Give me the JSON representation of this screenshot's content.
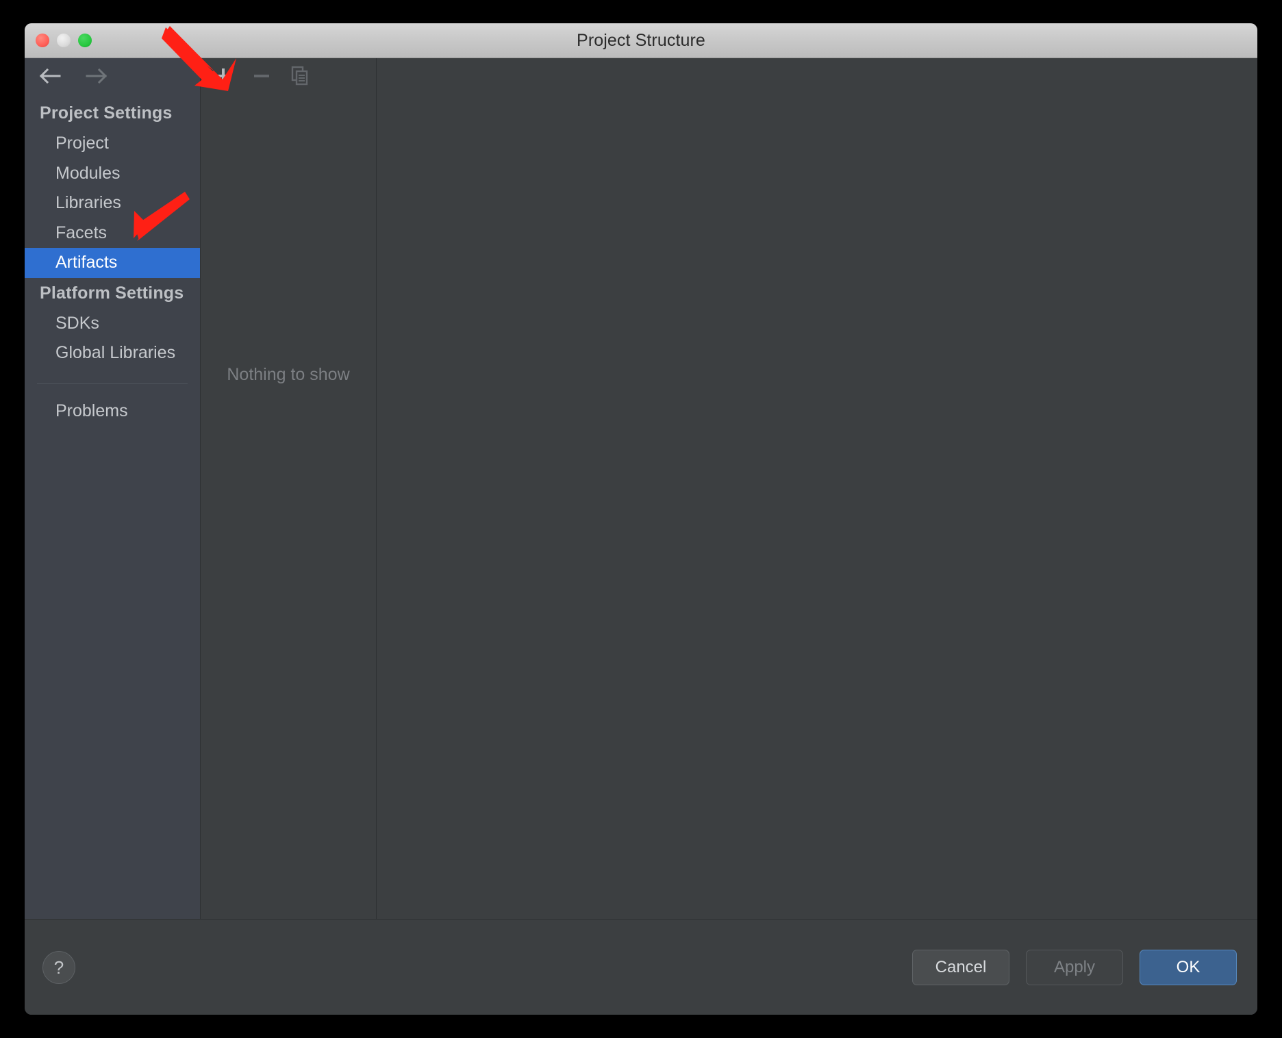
{
  "window": {
    "title": "Project Structure",
    "traffic_lights": [
      "close-red",
      "minimize-yellow",
      "maximize-green"
    ]
  },
  "navigation": {
    "back_icon": "arrow-left-icon",
    "forward_icon": "arrow-right-icon"
  },
  "sidebar": {
    "groups": [
      {
        "title": "Project Settings",
        "items": [
          {
            "label": "Project",
            "selected": false
          },
          {
            "label": "Modules",
            "selected": false
          },
          {
            "label": "Libraries",
            "selected": false
          },
          {
            "label": "Facets",
            "selected": false
          },
          {
            "label": "Artifacts",
            "selected": true
          }
        ]
      },
      {
        "title": "Platform Settings",
        "items": [
          {
            "label": "SDKs",
            "selected": false
          },
          {
            "label": "Global Libraries",
            "selected": false
          }
        ]
      }
    ],
    "footer_items": [
      {
        "label": "Problems",
        "selected": false
      }
    ]
  },
  "list_panel": {
    "toolbar": [
      {
        "name": "add-button",
        "icon": "plus-icon",
        "enabled": true
      },
      {
        "name": "remove-button",
        "icon": "minus-icon",
        "enabled": false
      },
      {
        "name": "copy-button",
        "icon": "copy-icon",
        "enabled": false
      }
    ],
    "empty_message": "Nothing to show"
  },
  "footer": {
    "help_label": "?",
    "cancel_label": "Cancel",
    "apply_label": "Apply",
    "ok_label": "OK"
  },
  "annotations": {
    "arrow_color": "#FF2015",
    "arrow_1_target": "add-button",
    "arrow_2_target": "facets-artifacts-area"
  },
  "colors": {
    "accent_selected": "#2f6fd0",
    "primary_button": "#3c628f",
    "panel_background": "#3c3f41",
    "sidebar_background": "#3f434b",
    "titlebar_background": "#c8c8c8"
  }
}
